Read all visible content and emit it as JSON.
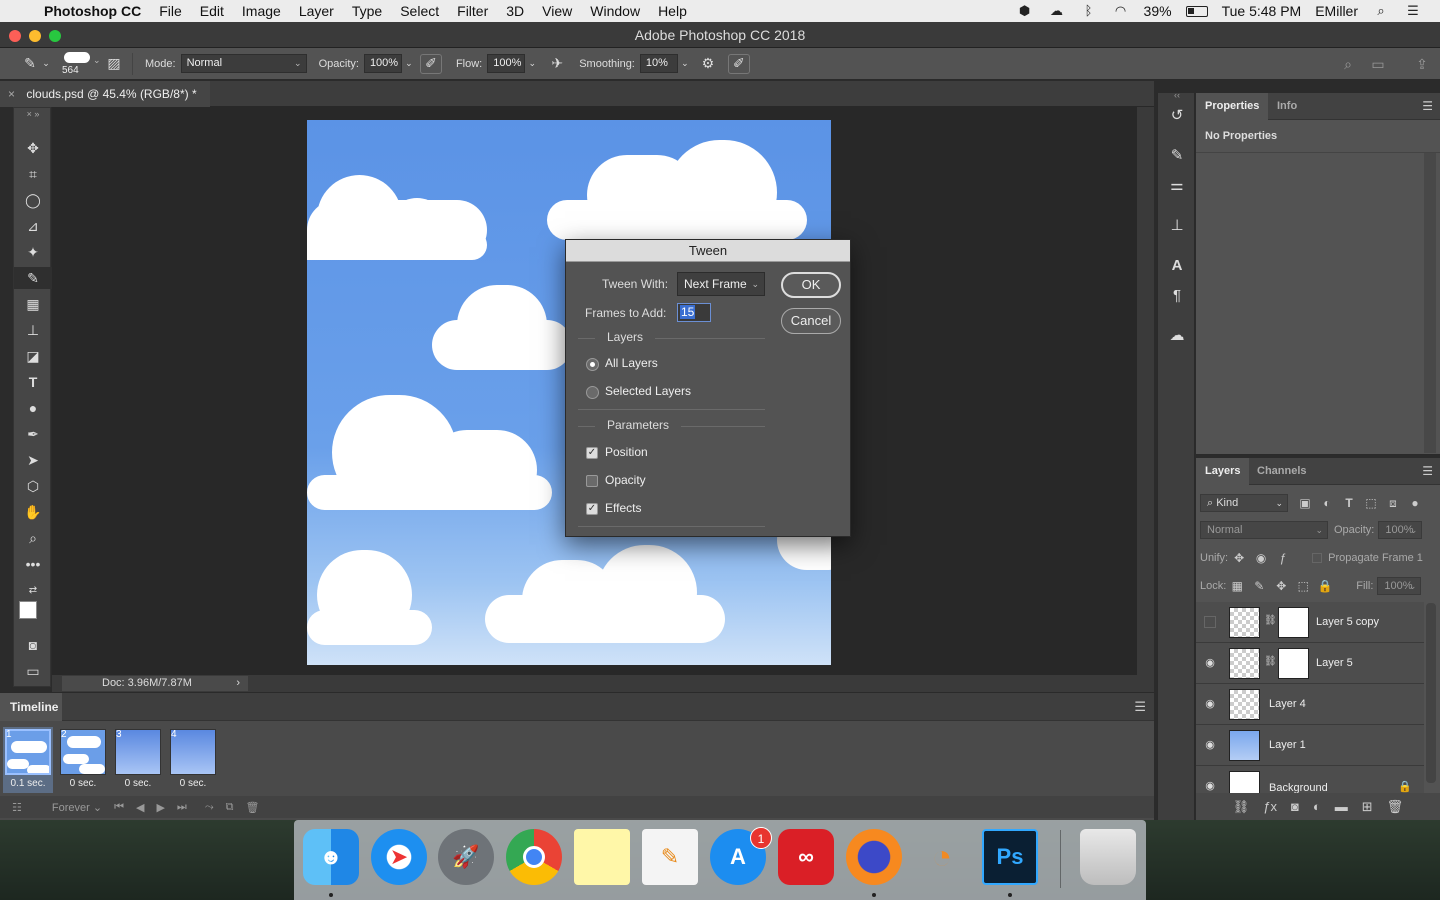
{
  "menubar": {
    "app_name": "Photoshop CC",
    "items": [
      "File",
      "Edit",
      "Image",
      "Layer",
      "Type",
      "Select",
      "Filter",
      "3D",
      "View",
      "Window",
      "Help"
    ],
    "battery": "39%",
    "clock": "Tue 5:48 PM",
    "user": "EMiller"
  },
  "window": {
    "title": "Adobe Photoshop CC 2018"
  },
  "options_bar": {
    "brush_size": "564",
    "mode_label": "Mode:",
    "mode_value": "Normal",
    "opacity_label": "Opacity:",
    "opacity_value": "100%",
    "flow_label": "Flow:",
    "flow_value": "100%",
    "smoothing_label": "Smoothing:",
    "smoothing_value": "10%"
  },
  "document": {
    "tab_title": "clouds.psd @ 45.4% (RGB/8*) *",
    "status": "Doc: 3.96M/7.87M"
  },
  "timeline": {
    "title": "Timeline",
    "frames": [
      {
        "num": "1",
        "delay": "0.1 sec.",
        "selected": true
      },
      {
        "num": "2",
        "delay": "0 sec.",
        "selected": false
      },
      {
        "num": "3",
        "delay": "0 sec.",
        "selected": false
      },
      {
        "num": "4",
        "delay": "0 sec.",
        "selected": false
      }
    ],
    "loop": "Forever"
  },
  "properties_panel": {
    "tabs": [
      "Properties",
      "Info"
    ],
    "body": "No Properties"
  },
  "layers_panel": {
    "tabs": [
      "Layers",
      "Channels"
    ],
    "filter_kind": "Kind",
    "blend_mode": "Normal",
    "opacity_label": "Opacity:",
    "opacity_value": "100%",
    "unify_label": "Unify:",
    "propagate_label": "Propagate Frame 1",
    "lock_label": "Lock:",
    "fill_label": "Fill:",
    "fill_value": "100%",
    "layers": [
      {
        "name": "Layer 5 copy",
        "visible": false,
        "mask": true
      },
      {
        "name": "Layer 5",
        "visible": true,
        "mask": true
      },
      {
        "name": "Layer 4",
        "visible": true,
        "mask": false
      },
      {
        "name": "Layer 1",
        "visible": true,
        "mask": false
      },
      {
        "name": "Background",
        "visible": true,
        "mask": false,
        "locked": true
      }
    ]
  },
  "tween_dialog": {
    "title": "Tween",
    "tween_with_label": "Tween With:",
    "tween_with_value": "Next Frame",
    "frames_label": "Frames to Add:",
    "frames_value": "15",
    "ok_label": "OK",
    "cancel_label": "Cancel",
    "layers_group": "Layers",
    "all_layers": "All Layers",
    "selected_layers": "Selected Layers",
    "layers_choice": "All Layers",
    "parameters_group": "Parameters",
    "position": "Position",
    "position_checked": true,
    "opacity": "Opacity",
    "opacity_checked": false,
    "effects": "Effects",
    "effects_checked": true
  },
  "dock": {
    "notification_badge": "1",
    "apps": [
      "finder-icon",
      "safari-icon",
      "launchpad-icon",
      "chrome-icon",
      "notes-icon",
      "pages-icon",
      "app-store-icon",
      "creative-cloud-icon",
      "firefox-icon",
      "blender-icon",
      "photoshop-icon",
      "trash-icon"
    ],
    "photoshop_label": "Ps"
  }
}
